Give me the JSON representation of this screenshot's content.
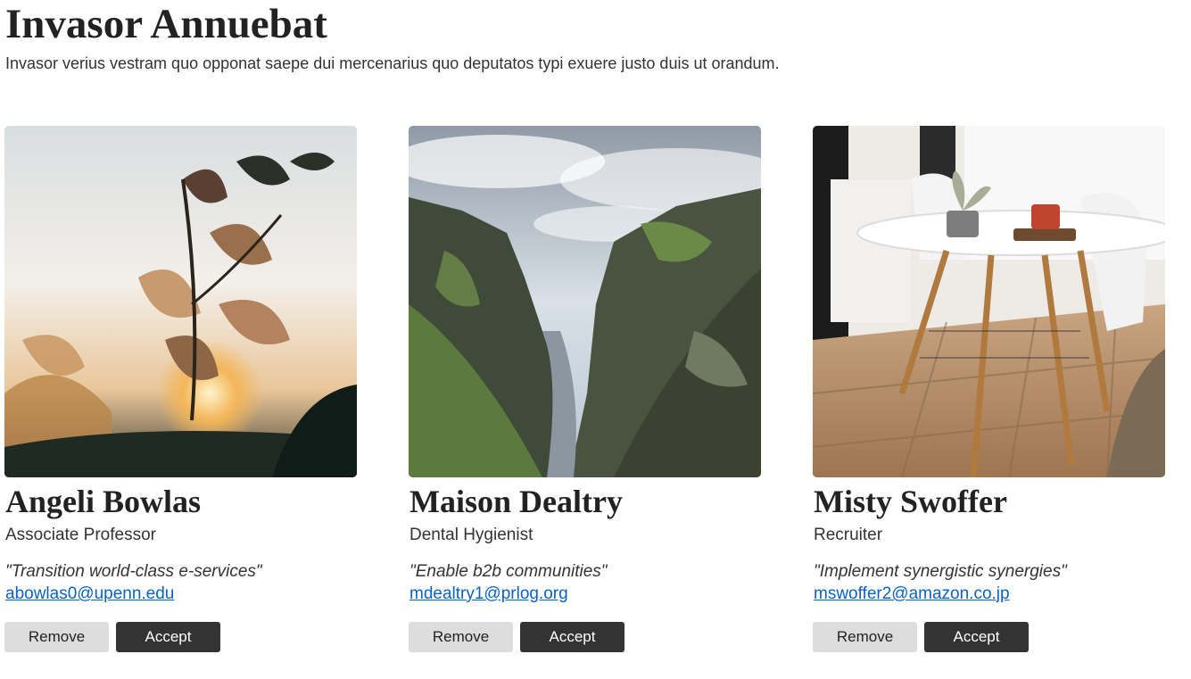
{
  "header": {
    "title": "Invasor Annuebat",
    "subtitle": "Invasor verius vestram quo opponat saepe dui mercenarius quo deputatos typi exuere justo duis ut orandum."
  },
  "cards": [
    {
      "name": "Angeli Bowlas",
      "role": "Associate Professor",
      "quote": "\"Transition world-class e-services\"",
      "email": "abowlas0@upenn.edu",
      "remove_label": "Remove",
      "accept_label": "Accept"
    },
    {
      "name": "Maison Dealtry",
      "role": "Dental Hygienist",
      "quote": "\"Enable b2b communities\"",
      "email": "mdealtry1@prlog.org",
      "remove_label": "Remove",
      "accept_label": "Accept"
    },
    {
      "name": "Misty Swoffer",
      "role": "Recruiter",
      "quote": "\"Implement synergistic synergies\"",
      "email": "mswoffer2@amazon.co.jp",
      "remove_label": "Remove",
      "accept_label": "Accept"
    }
  ],
  "colors": {
    "link": "#0b62c4",
    "accept_bg": "#333333",
    "remove_bg": "#dddddd"
  }
}
